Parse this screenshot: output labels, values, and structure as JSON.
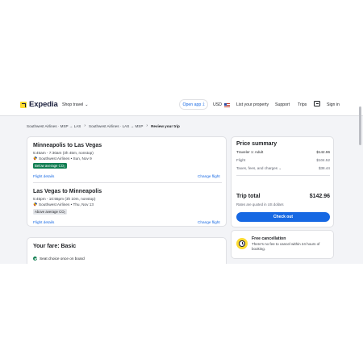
{
  "header": {
    "logo_text": "Expedia",
    "shop_travel": "Shop travel",
    "get_app": "Open app",
    "currency": "USD",
    "list_property": "List your property",
    "support": "Support",
    "trips": "Trips",
    "sign_in": "Sign in"
  },
  "breadcrumb": {
    "items": [
      "Southwest Airlines · MSP → LAS",
      "Southwest Airlines · LAS → MSP",
      "Review your trip"
    ]
  },
  "flights": [
    {
      "title": "Minneapolis to Las Vegas",
      "time": "5:45am - 7:30am (3h 45m, nonstop)",
      "airline": "Southwest Airlines • Sun, Nov 9",
      "badge": "Below average CO₂",
      "details_link": "Flight details",
      "change_link": "Change flight"
    },
    {
      "title": "Las Vegas to Minneapolis",
      "time": "5:45pm - 10:55pm (3h 10m, nonstop)",
      "airline": "Southwest Airlines • Thu, Nov 13",
      "badge": "Above average CO₂",
      "details_link": "Flight details",
      "change_link": "Change flight"
    }
  ],
  "fare": {
    "title": "Your fare: Basic",
    "feature": "Seat choice once on board"
  },
  "price_summary": {
    "title": "Price summary",
    "traveler_label": "Traveler 1: Adult",
    "traveler_value": "$142.96",
    "flight_label": "Flight",
    "flight_value": "$104.52",
    "taxes_label": "Taxes, fees, and charges",
    "taxes_value": "$38.44",
    "total_label": "Trip total",
    "total_value": "$142.96",
    "note": "Rates are quoted in US dollars",
    "checkout": "Check out"
  },
  "cancellation": {
    "title": "Free cancellation",
    "text": "There's no fee to cancel within 24 hours of booking."
  },
  "colors": {
    "brand": "#191e3b",
    "accent": "#1668e3",
    "logo_yellow": "#fddb32",
    "green_badge": "#127f53"
  }
}
